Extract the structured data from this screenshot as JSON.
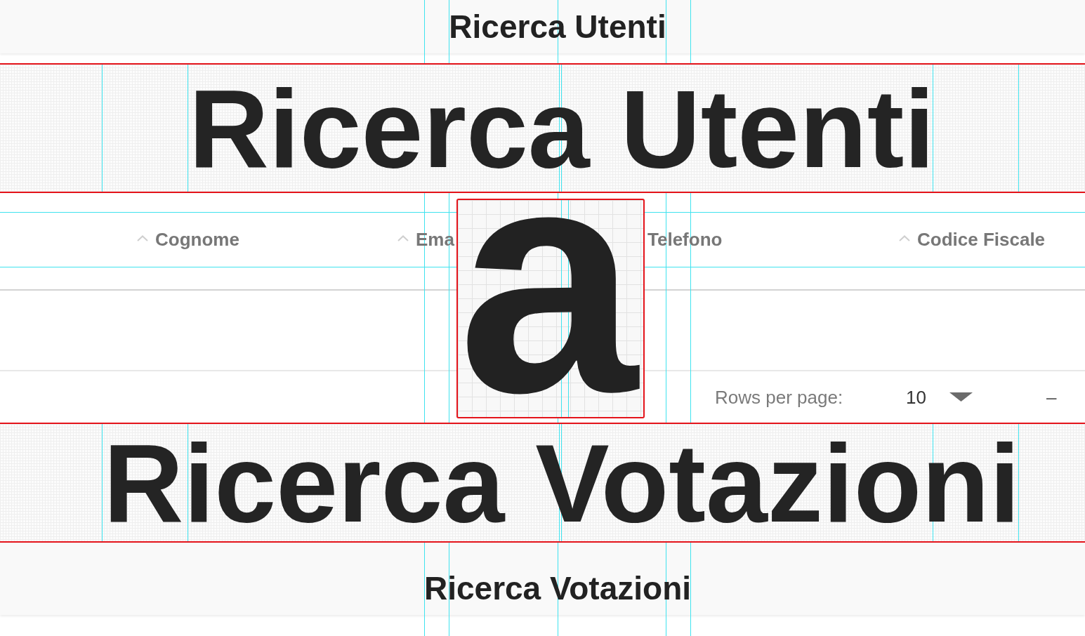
{
  "header": {
    "title": "Ricerca Utenti"
  },
  "table": {
    "columns": [
      {
        "label": "Cognome",
        "sort_icon": true
      },
      {
        "label": "Ema",
        "sort_icon": true
      },
      {
        "label": "Telefono",
        "sort_icon": false
      },
      {
        "label": "Codice Fiscale",
        "sort_icon": true
      }
    ]
  },
  "pagination": {
    "rows_per_page_label": "Rows per page:",
    "rows_per_page": "10",
    "range": "–"
  },
  "section": {
    "title": "Ricerca Votazioni"
  },
  "magnifiers": [
    {
      "kind": "band",
      "text": "Ricerca Utenti"
    },
    {
      "kind": "glyph",
      "text": "a"
    },
    {
      "kind": "band",
      "text": "Ricerca Votazioni"
    }
  ]
}
